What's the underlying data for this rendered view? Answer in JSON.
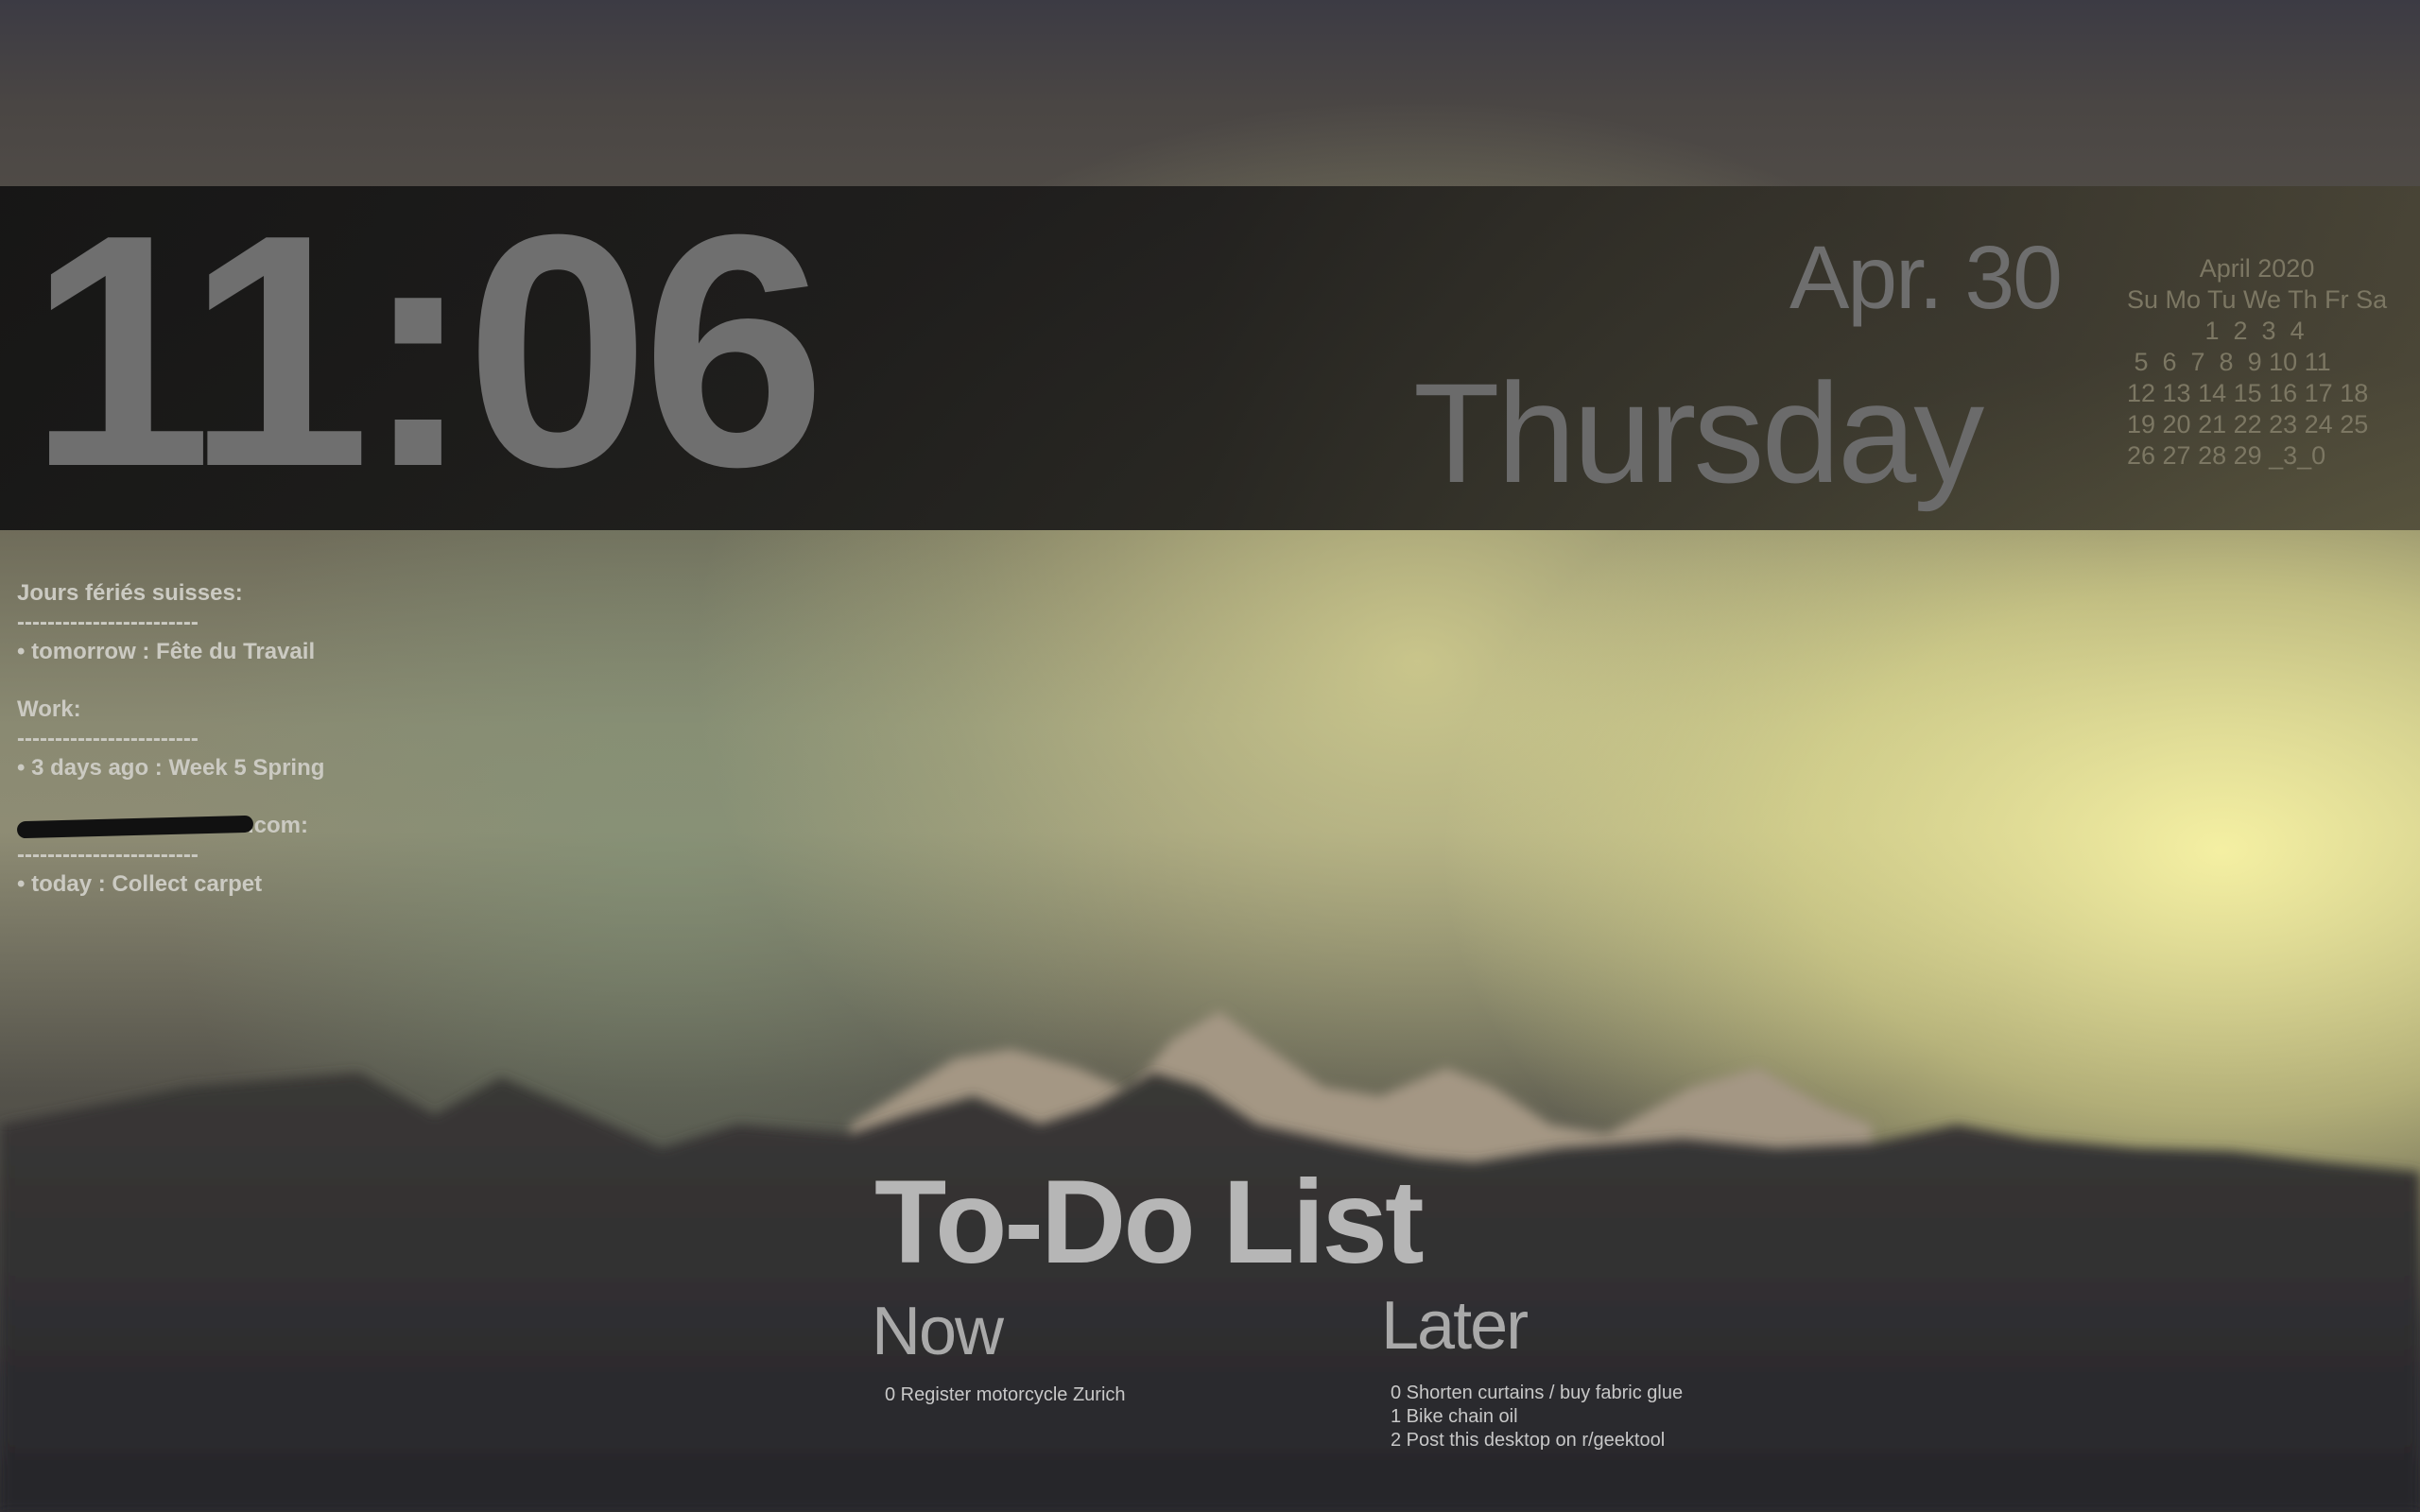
{
  "clock": {
    "time": "11:06"
  },
  "date": {
    "short_date": "Apr. 30",
    "weekday": "Thursday"
  },
  "calendar": {
    "title": "April 2020",
    "rows": [
      "Su Mo Tu We Th Fr Sa",
      "           1  2  3  4",
      " 5  6  7  8  9 10 11",
      "12 13 14 15 16 17 18",
      "19 20 21 22 23 24 25",
      "26 27 28 29 _3_0"
    ]
  },
  "events": {
    "groups": [
      {
        "title": "Jours fériés suisses:",
        "separator": "------------------------",
        "items": [
          "• tomorrow : Fête du Travail"
        ]
      },
      {
        "title": "Work:",
        "separator": "------------------------",
        "items": [
          "• 3 days ago : Week 5 Spring"
        ]
      },
      {
        "title": ".com:",
        "separator": "------------------------",
        "items": [
          "• today : Collect carpet"
        ]
      }
    ]
  },
  "todo": {
    "title": "To-Do List",
    "now": {
      "label": "Now",
      "items": [
        "0 Register motorcycle Zurich"
      ]
    },
    "later": {
      "label": "Later",
      "items": [
        "0 Shorten curtains / buy fabric glue",
        "1 Bike chain oil",
        "2 Post this desktop on r/geektool"
      ]
    }
  }
}
